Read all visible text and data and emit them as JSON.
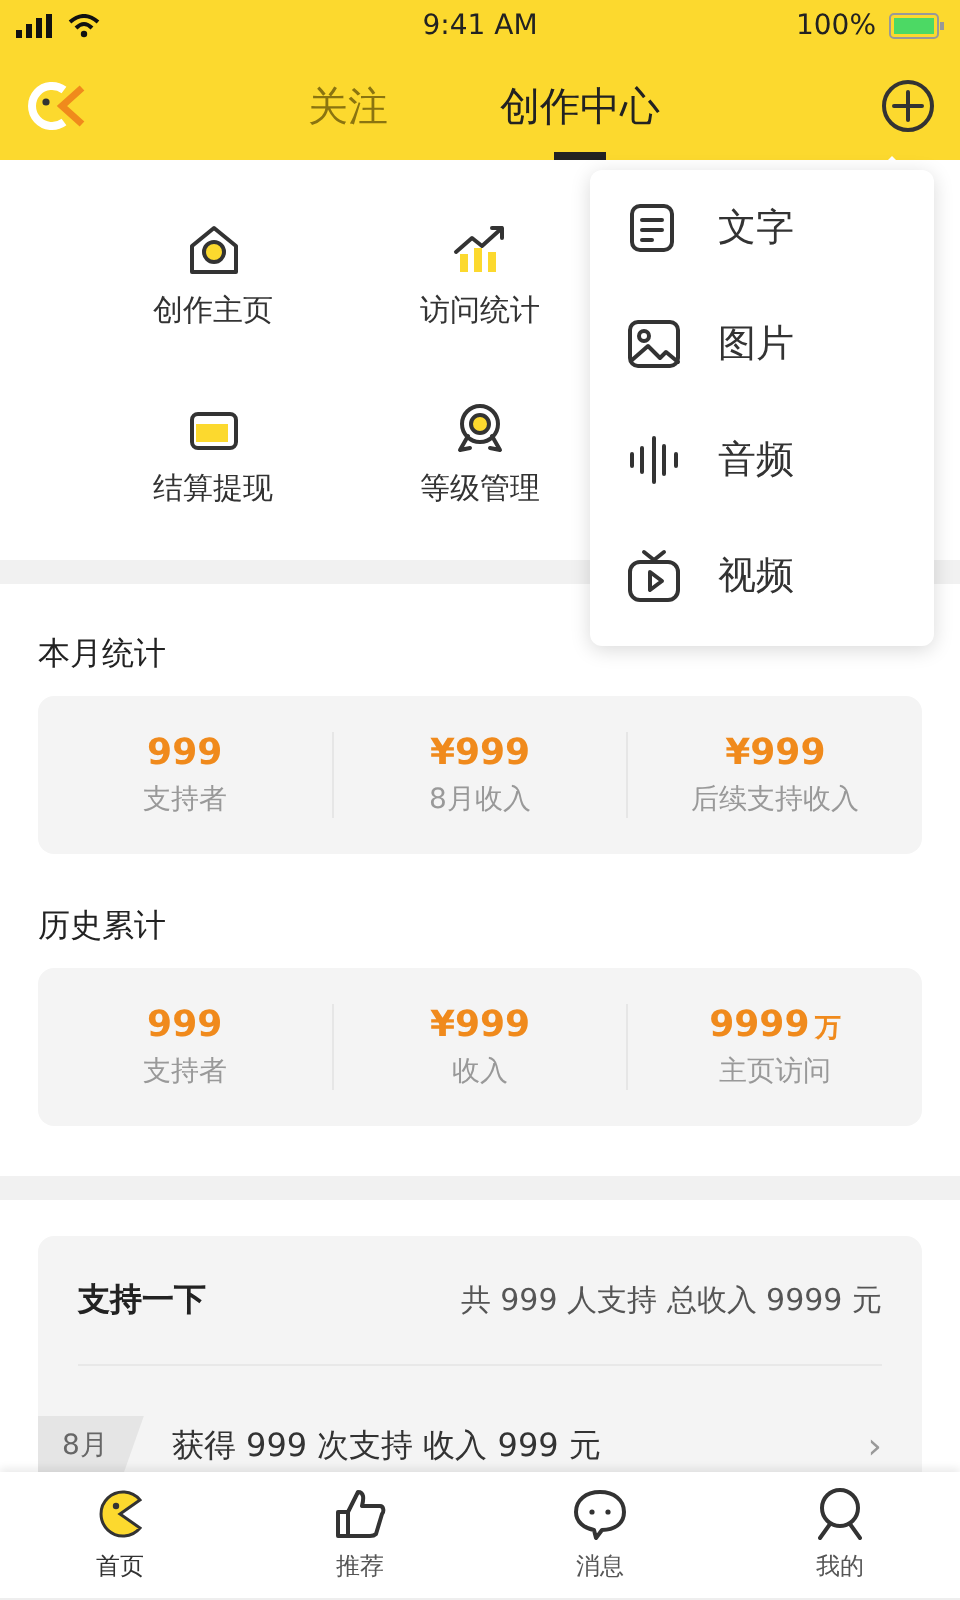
{
  "status_bar": {
    "time": "9:41 AM",
    "battery": "100%"
  },
  "header": {
    "tabs": [
      {
        "label": "关注",
        "selected": false
      },
      {
        "label": "创作中心",
        "selected": true
      }
    ]
  },
  "shortcuts": [
    {
      "label": "创作主页",
      "kind": "home"
    },
    {
      "label": "访问统计",
      "kind": "chart"
    },
    {
      "label": "结算提现",
      "kind": "wallet"
    },
    {
      "label": "等级管理",
      "kind": "medal"
    }
  ],
  "menu": [
    {
      "label": "文字",
      "kind": "text"
    },
    {
      "label": "图片",
      "kind": "image"
    },
    {
      "label": "音频",
      "kind": "audio"
    },
    {
      "label": "视频",
      "kind": "video"
    }
  ],
  "stat_groups": [
    {
      "title": "本月统计",
      "items": [
        {
          "value": "999",
          "label": "支持者"
        },
        {
          "value": "¥999",
          "label": "8月收入"
        },
        {
          "value": "¥999",
          "label": "后续支持收入"
        }
      ]
    },
    {
      "title": "历史累计",
      "items": [
        {
          "value": "999",
          "label": "支持者"
        },
        {
          "value": "¥999",
          "label": "收入"
        },
        {
          "value": "9999",
          "unit": "万",
          "label": "主页访问"
        }
      ]
    }
  ],
  "support": {
    "title": "支持一下",
    "summary": "共 999 人支持  总收入 9999 元",
    "rows": [
      {
        "month": "8月",
        "text": "获得 999 次支持  收入 999 元",
        "arrow": "›"
      }
    ]
  },
  "tab_bar": [
    {
      "label": "首页",
      "kind": "home",
      "selected": true
    },
    {
      "label": "推荐",
      "kind": "thumb",
      "selected": false
    },
    {
      "label": "消息",
      "kind": "chat",
      "selected": false
    },
    {
      "label": "我的",
      "kind": "user",
      "selected": false
    }
  ]
}
